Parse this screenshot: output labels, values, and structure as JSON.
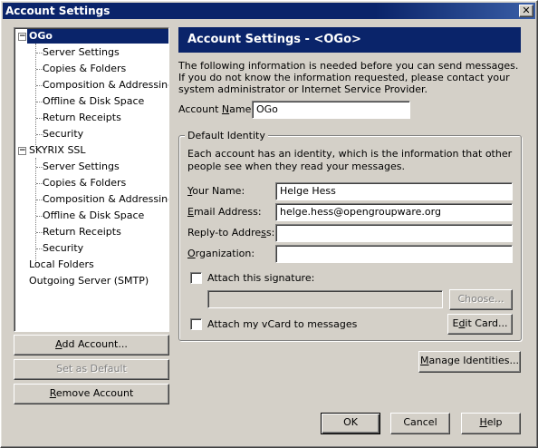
{
  "window": {
    "title": "Account Settings",
    "close_glyph": "✕"
  },
  "tree": {
    "accounts": [
      {
        "name": "OGo",
        "expander": "−",
        "children": [
          "Server Settings",
          "Copies & Folders",
          "Composition & Addressing",
          "Offline & Disk Space",
          "Return Receipts",
          "Security"
        ]
      },
      {
        "name": "SKYRIX SSL",
        "expander": "−",
        "children": [
          "Server Settings",
          "Copies & Folders",
          "Composition & Addressing",
          "Offline & Disk Space",
          "Return Receipts",
          "Security"
        ]
      }
    ],
    "others": [
      "Local Folders",
      "Outgoing Server (SMTP)"
    ]
  },
  "left_buttons": {
    "add_account": {
      "pre": "",
      "u": "A",
      "post": "dd Account..."
    },
    "set_default": "Set as Default",
    "remove_account": {
      "pre": "",
      "u": "R",
      "post": "emove Account"
    }
  },
  "panel": {
    "header": "Account Settings - <OGo>",
    "intro": "The following information is needed before you can send messages. If you do not know the information requested, please contact your system administrator or Internet Service Provider.",
    "account_name": {
      "pre": "Account ",
      "u": "N",
      "post": "ame:",
      "value": "OGo"
    },
    "identity": {
      "legend": "Default Identity",
      "description": "Each account has an identity, which is the information that other people see when they read your messages.",
      "your_name": {
        "pre": "",
        "u": "Y",
        "post": "our Name:",
        "value": "Helge Hess"
      },
      "email": {
        "pre": "",
        "u": "E",
        "post": "mail Address:",
        "value": "helge.hess@opengroupware.org"
      },
      "reply_to": {
        "pre": "Reply-to Addre",
        "u": "s",
        "post": "s:",
        "value": ""
      },
      "organization": {
        "pre": "",
        "u": "O",
        "post": "rganization:",
        "value": ""
      },
      "attach_signature": {
        "label": "Attach this signature:",
        "checked": false,
        "path": ""
      },
      "choose_button": "Choose...",
      "attach_vcard": {
        "label": "Attach my vCard to messages",
        "checked": false
      },
      "edit_card": {
        "pre": "E",
        "u": "d",
        "post": "it Card..."
      }
    },
    "manage_identities": {
      "pre": "",
      "u": "M",
      "post": "anage Identities..."
    }
  },
  "footer": {
    "ok": "OK",
    "cancel": "Cancel",
    "help": {
      "pre": "",
      "u": "H",
      "post": "elp"
    }
  }
}
